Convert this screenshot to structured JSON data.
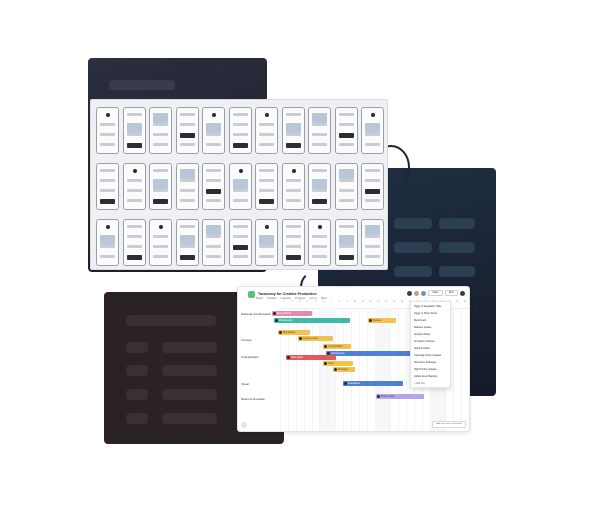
{
  "project": {
    "title": "Taxonomy for Creative Production",
    "tabs": [
      "Board",
      "Timeline",
      "Calendar",
      "Progress",
      "Forms",
      "More..."
    ],
    "share_label": "Share",
    "filter_label": "Filter"
  },
  "timeline": {
    "dates": [
      "1",
      "2",
      "3",
      "4",
      "5",
      "6",
      "7",
      "8",
      "9",
      "10",
      "11",
      "12",
      "13",
      "14",
      "15",
      "16",
      "17",
      "18",
      "19",
      "20",
      "21",
      "22",
      "23",
      "24"
    ],
    "groups": [
      "Rationale and Research",
      "Concept",
      "UI Exploration",
      "Visual",
      "Motion & Animation"
    ],
    "tasks": [
      {
        "label": "Brand kickoff",
        "color": "pink"
      },
      {
        "label": "Moodboards",
        "color": "teal"
      },
      {
        "label": "Review",
        "color": "yellow"
      },
      {
        "label": "Wireframes",
        "color": "yellow"
      },
      {
        "label": "Layout review",
        "color": "yellow"
      },
      {
        "label": "UI exploration",
        "color": "yellow"
      },
      {
        "label": "Components",
        "color": "blue"
      },
      {
        "label": "Style guide",
        "color": "red"
      },
      {
        "label": "Icons",
        "color": "yellow"
      },
      {
        "label": "Prototype",
        "color": "yellow"
      },
      {
        "label": "Illustrations",
        "color": "blue"
      },
      {
        "label": "Motion study",
        "color": "purple"
      }
    ],
    "dropdown_items": [
      "Taggy to Regulation Table",
      "Taggy to Photo Shoot",
      "Benchmark",
      "Baseline Guides",
      "Analytics Briefs",
      "Animation Libraries",
      "Alpha Frontline",
      "Campaign Scout Updates",
      "Alternative Pathways",
      "High Priority Updates",
      "Global Asset Mapping"
    ],
    "dropdown_add": "Add row",
    "toast": "Add more tasks to timeline"
  }
}
